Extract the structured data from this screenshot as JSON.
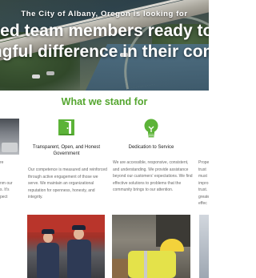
{
  "hero": {
    "kicker": "The City of Albany, Oregon is looking for",
    "headline_line1": "red team members ready to m",
    "headline_line2": "ingful difference in their comm"
  },
  "section": {
    "title": "What we stand for"
  },
  "values": [
    {
      "icon": "door-icon",
      "title": "Transparent, Open, and Honest Government",
      "body": "Our competence is measured and reinforced through active engagement of those we serve. We maintain an organizational reputation for openness, honesty, and integrity."
    },
    {
      "icon": "lightbulb-icon",
      "title": "Dedication to Service",
      "body": "We are accessible, responsive, consistent, and understanding. We provide assistance beyond our customers' expectations. We find effective solutions to problems that the community brings to our attention."
    }
  ],
  "left_fragments": [
    "re",
    "",
    "",
    "nm our",
    "s. It's",
    "pect"
  ],
  "right_fragments": [
    "Prope",
    "trust",
    "must",
    "impro",
    "trust.",
    "greate",
    "effec"
  ],
  "photos": [
    {
      "name": "police-officers-photo"
    },
    {
      "name": "public-works-photo"
    }
  ],
  "colors": {
    "accent_green": "#55a630",
    "text_dark": "#222222",
    "text_body": "#6a6a6a"
  }
}
